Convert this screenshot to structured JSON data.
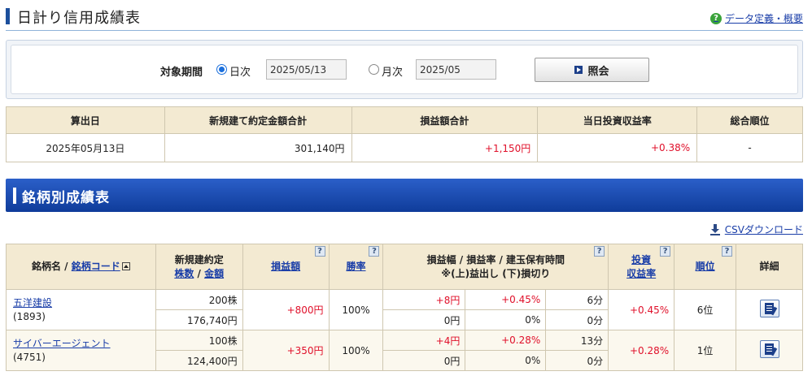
{
  "page": {
    "title": "日計り信用成績表",
    "help_link": "データ定義・概要"
  },
  "period": {
    "label": "対象期間",
    "daily_label": "日次",
    "daily_value": "2025/05/13",
    "monthly_label": "月次",
    "monthly_value": "2025/05",
    "inquiry_label": "照会"
  },
  "summary": {
    "headers": [
      "算出日",
      "新規建て約定金額合計",
      "損益額合計",
      "当日投資収益率",
      "総合順位"
    ],
    "calc_date": "2025年05月13日",
    "contract_total": "301,140円",
    "pl_total": "+1,150円",
    "return_rate": "+0.38%",
    "rank": "-"
  },
  "section": {
    "title": "銘柄別成績表",
    "csv_link": "CSVダウンロード"
  },
  "detail_headers": {
    "name": "銘柄名",
    "slash": " / ",
    "code": "銘柄コード",
    "contract_line1": "新規建約定",
    "shares": "株数",
    "amount": "金額",
    "pl": "損益額",
    "win_rate": "勝率",
    "range_line1": "損益幅 / 損益率 / 建玉保有時間",
    "range_line2": "※(上)益出し (下)損切り",
    "return_line1": "投資",
    "return_line2": "収益率",
    "rank": "順位",
    "detail": "詳細",
    "help": "?"
  },
  "rows": [
    {
      "name": "五洋建設",
      "code": "(1893)",
      "shares": "200株",
      "amount": "176,740円",
      "pl": "+800円",
      "win_rate": "100%",
      "gain_width": "+8円",
      "gain_rate": "+0.45%",
      "gain_time": "6分",
      "loss_width": "0円",
      "loss_rate": "0%",
      "loss_time": "0分",
      "return_rate": "+0.45%",
      "rank": "6位"
    },
    {
      "name": "サイバーエージェント",
      "code": "(4751)",
      "shares": "100株",
      "amount": "124,400円",
      "pl": "+350円",
      "win_rate": "100%",
      "gain_width": "+4円",
      "gain_rate": "+0.28%",
      "gain_time": "13分",
      "loss_width": "0円",
      "loss_rate": "0%",
      "loss_time": "0分",
      "return_rate": "+0.28%",
      "rank": "1位"
    }
  ],
  "colors": {
    "accent_blue": "#1c4f9c",
    "positive_red": "#e0102a",
    "header_beige": "#f3ead2"
  }
}
